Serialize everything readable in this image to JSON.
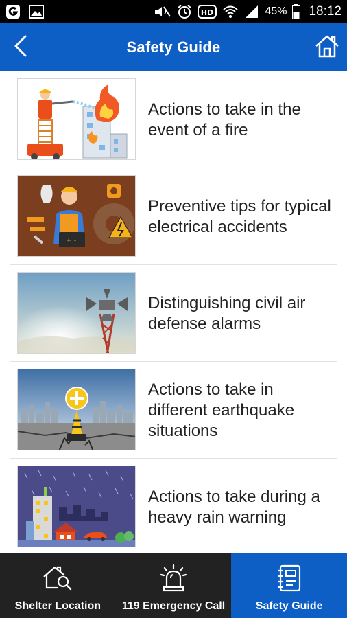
{
  "status_bar": {
    "battery_percent": "45%",
    "time": "18:12",
    "icons": [
      "notification-app-icon",
      "image-icon",
      "mute-icon",
      "alarm-icon",
      "hd-icon",
      "wifi-icon",
      "signal-icon",
      "battery-icon"
    ]
  },
  "header": {
    "title": "Safety Guide",
    "back_icon": "chevron-left-icon",
    "home_icon": "home-icon"
  },
  "guides": [
    {
      "label": "Actions to take in the event of a fire",
      "thumbnail": "firefighter-building-fire"
    },
    {
      "label": "Preventive tips for typical electrical accidents",
      "thumbnail": "electrician-tools"
    },
    {
      "label": "Distinguishing civil air defense alarms",
      "thumbnail": "siren-tower-sky"
    },
    {
      "label": "Actions to take in different earthquake situations",
      "thumbnail": "cracked-ground-city"
    },
    {
      "label": "Actions to take during a heavy rain warning",
      "thumbnail": "night-rain-city"
    }
  ],
  "bottom_nav": {
    "tabs": [
      {
        "label": "Shelter Location",
        "icon": "shelter-search-icon",
        "active": false
      },
      {
        "label": "119 Emergency Call",
        "icon": "emergency-siren-icon",
        "active": false
      },
      {
        "label": "Safety Guide",
        "icon": "guide-book-icon",
        "active": true
      }
    ]
  },
  "colors": {
    "primary": "#0d5ec5",
    "nav_background": "#222222",
    "text": "#222222"
  }
}
